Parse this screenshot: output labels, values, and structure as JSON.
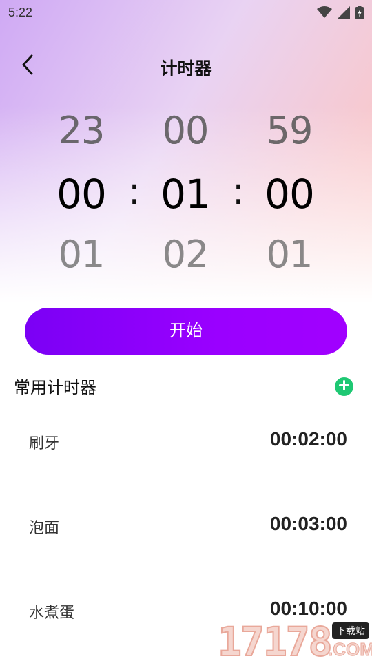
{
  "status_bar": {
    "time": "5:22"
  },
  "header": {
    "title": "计时器"
  },
  "picker": {
    "hours": {
      "prev": "23",
      "current": "00",
      "next": "01"
    },
    "minutes": {
      "prev": "00",
      "current": "01",
      "next": "02"
    },
    "seconds": {
      "prev": "59",
      "current": "00",
      "next": "01"
    },
    "separator": ":"
  },
  "start_button": {
    "label": "开始"
  },
  "common_timers": {
    "title": "常用计时器",
    "items": [
      {
        "name": "刷牙",
        "duration": "00:02:00"
      },
      {
        "name": "泡面",
        "duration": "00:03:00"
      },
      {
        "name": "水煮蛋",
        "duration": "00:10:00"
      }
    ]
  },
  "watermark": {
    "number": "17178",
    "badge": "下载站",
    "suffix": ".COM"
  },
  "colors": {
    "accent_purple": "#9a00ff",
    "add_green": "#1ec873"
  }
}
